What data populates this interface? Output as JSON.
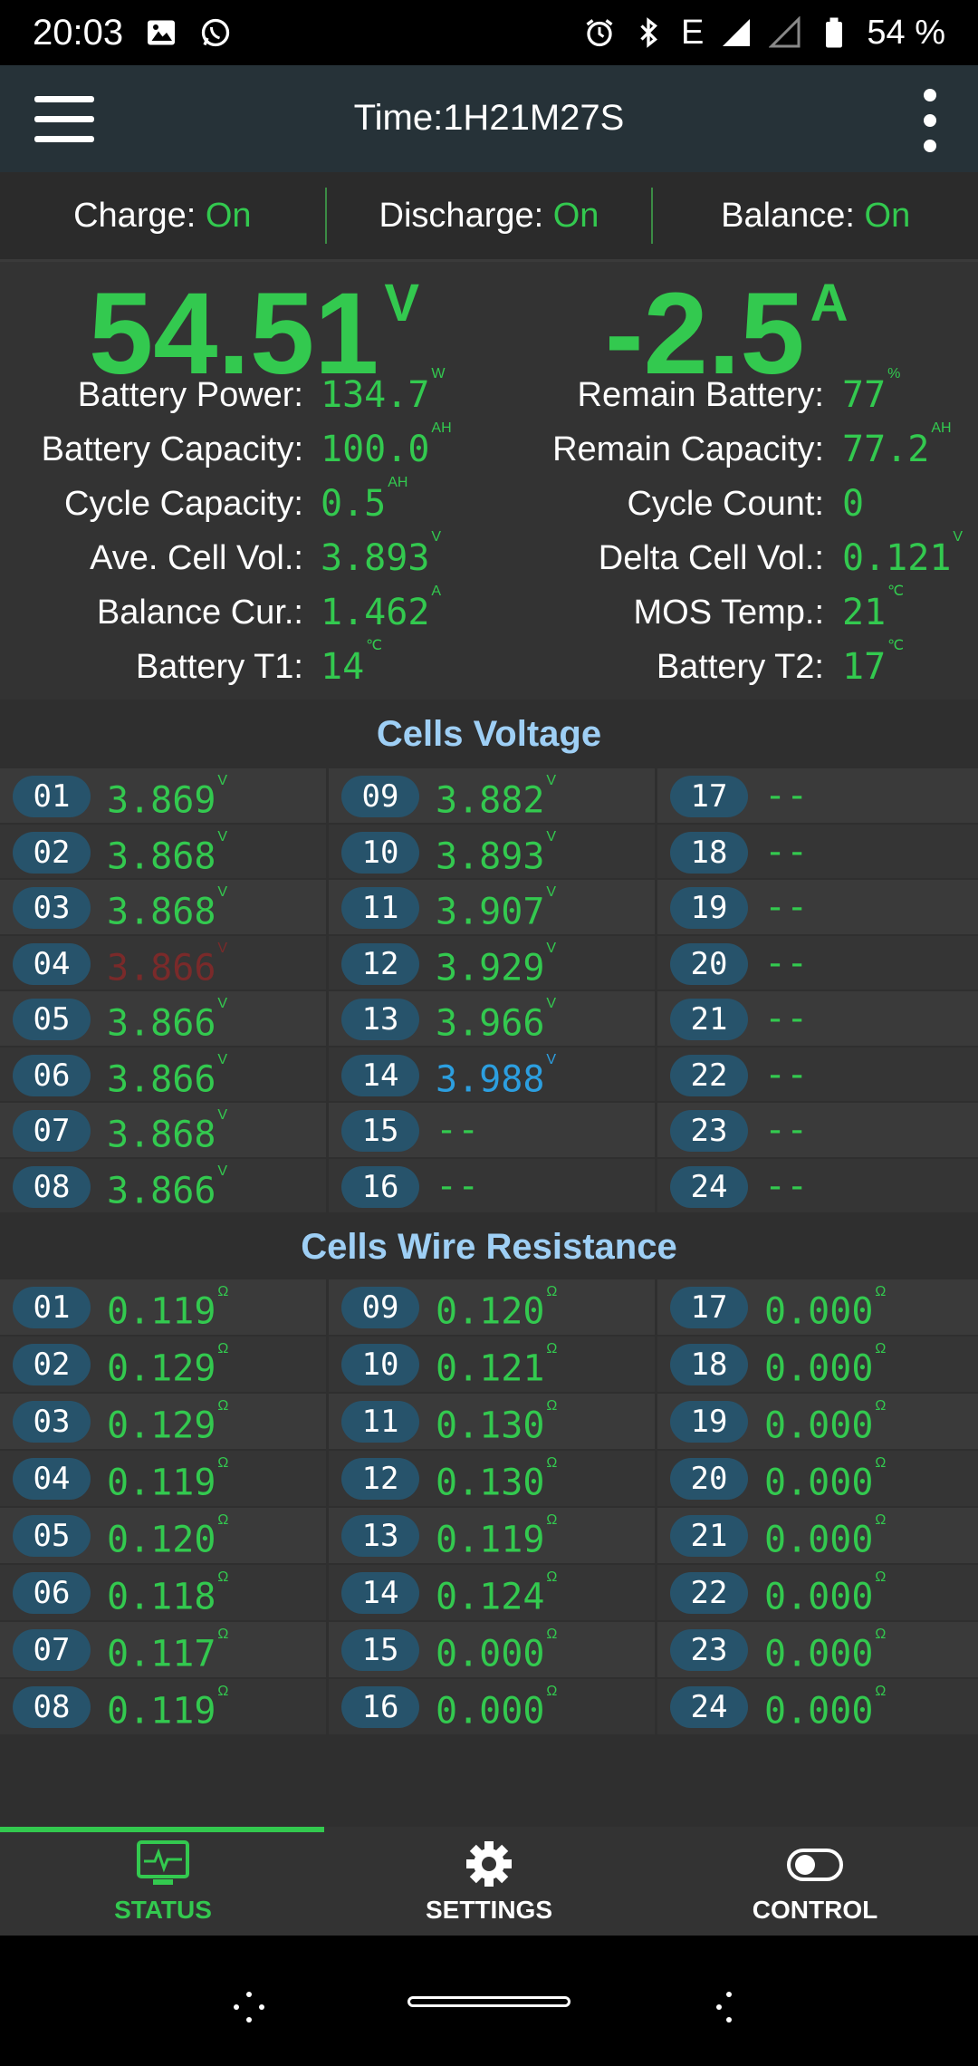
{
  "statusbar": {
    "time": "20:03",
    "network": "E",
    "battery": "54 %",
    "icons": [
      "image-icon",
      "whatsapp-icon",
      "alarm-icon",
      "bluetooth-icon",
      "signal-icon",
      "battery-icon"
    ]
  },
  "appbar": {
    "title": "Time:1H21M27S"
  },
  "toggles": [
    {
      "label": "Charge: ",
      "value": "On"
    },
    {
      "label": "Discharge: ",
      "value": "On"
    },
    {
      "label": "Balance: ",
      "value": "On"
    }
  ],
  "summary": {
    "voltage": "54.51",
    "voltage_unit": "V",
    "current": "-2.5",
    "current_unit": "A",
    "left": [
      {
        "label": "Battery Power:",
        "value": "134.7",
        "unit": "W"
      },
      {
        "label": "Battery Capacity:",
        "value": "100.0",
        "unit": "AH"
      },
      {
        "label": "Cycle Capacity:",
        "value": "0.5",
        "unit": "AH"
      },
      {
        "label": "Ave. Cell Vol.:",
        "value": "3.893",
        "unit": "V"
      },
      {
        "label": "Balance Cur.:",
        "value": "1.462",
        "unit": "A"
      },
      {
        "label": "Battery T1:",
        "value": "14",
        "unit": "℃"
      }
    ],
    "right": [
      {
        "label": "Remain Battery:",
        "value": "77",
        "unit": "%"
      },
      {
        "label": "Remain Capacity:",
        "value": "77.2",
        "unit": "AH"
      },
      {
        "label": "Cycle Count:",
        "value": "0",
        "unit": ""
      },
      {
        "label": "Delta Cell Vol.:",
        "value": "0.121",
        "unit": "V"
      },
      {
        "label": "MOS Temp.:",
        "value": "21",
        "unit": "℃"
      },
      {
        "label": "Battery T2:",
        "value": "17",
        "unit": "℃"
      }
    ]
  },
  "cells_voltage": {
    "title": "Cells Voltage",
    "unit": "V",
    "cells": [
      {
        "id": "01",
        "value": "3.869"
      },
      {
        "id": "02",
        "value": "3.868"
      },
      {
        "id": "03",
        "value": "3.868"
      },
      {
        "id": "04",
        "value": "3.866"
      },
      {
        "id": "05",
        "value": "3.866"
      },
      {
        "id": "06",
        "value": "3.866"
      },
      {
        "id": "07",
        "value": "3.868"
      },
      {
        "id": "08",
        "value": "3.866"
      },
      {
        "id": "09",
        "value": "3.882"
      },
      {
        "id": "10",
        "value": "3.893"
      },
      {
        "id": "11",
        "value": "3.907"
      },
      {
        "id": "12",
        "value": "3.929"
      },
      {
        "id": "13",
        "value": "3.966"
      },
      {
        "id": "14",
        "value": "3.988"
      },
      {
        "id": "15",
        "value": "--"
      },
      {
        "id": "16",
        "value": "--"
      },
      {
        "id": "17",
        "value": "--"
      },
      {
        "id": "18",
        "value": "--"
      },
      {
        "id": "19",
        "value": "--"
      },
      {
        "id": "20",
        "value": "--"
      },
      {
        "id": "21",
        "value": "--"
      },
      {
        "id": "22",
        "value": "--"
      },
      {
        "id": "23",
        "value": "--"
      },
      {
        "id": "24",
        "value": "--"
      }
    ],
    "min_cell": "04",
    "max_cell": "14",
    "colors": {
      "normal": "#33c94f",
      "max": "#2c9fe0",
      "min": "#7a2a2a"
    }
  },
  "cells_resistance": {
    "title": "Cells Wire Resistance",
    "unit": "Ω",
    "cells": [
      {
        "id": "01",
        "value": "0.119"
      },
      {
        "id": "02",
        "value": "0.129"
      },
      {
        "id": "03",
        "value": "0.129"
      },
      {
        "id": "04",
        "value": "0.119"
      },
      {
        "id": "05",
        "value": "0.120"
      },
      {
        "id": "06",
        "value": "0.118"
      },
      {
        "id": "07",
        "value": "0.117"
      },
      {
        "id": "08",
        "value": "0.119"
      },
      {
        "id": "09",
        "value": "0.120"
      },
      {
        "id": "10",
        "value": "0.121"
      },
      {
        "id": "11",
        "value": "0.130"
      },
      {
        "id": "12",
        "value": "0.130"
      },
      {
        "id": "13",
        "value": "0.119"
      },
      {
        "id": "14",
        "value": "0.124"
      },
      {
        "id": "15",
        "value": "0.000"
      },
      {
        "id": "16",
        "value": "0.000"
      },
      {
        "id": "17",
        "value": "0.000"
      },
      {
        "id": "18",
        "value": "0.000"
      },
      {
        "id": "19",
        "value": "0.000"
      },
      {
        "id": "20",
        "value": "0.000"
      },
      {
        "id": "21",
        "value": "0.000"
      },
      {
        "id": "22",
        "value": "0.000"
      },
      {
        "id": "23",
        "value": "0.000"
      },
      {
        "id": "24",
        "value": "0.000"
      }
    ]
  },
  "bottomnav": [
    {
      "label": "STATUS",
      "icon": "monitor-pulse-icon",
      "active": true
    },
    {
      "label": "SETTINGS",
      "icon": "gear-icon",
      "active": false
    },
    {
      "label": "CONTROL",
      "icon": "toggle-switch-icon",
      "active": false
    }
  ],
  "colors": {
    "accent": "#33c94f",
    "appbar": "#263238",
    "section_title": "#9ecff5",
    "badge": "#27536b"
  }
}
